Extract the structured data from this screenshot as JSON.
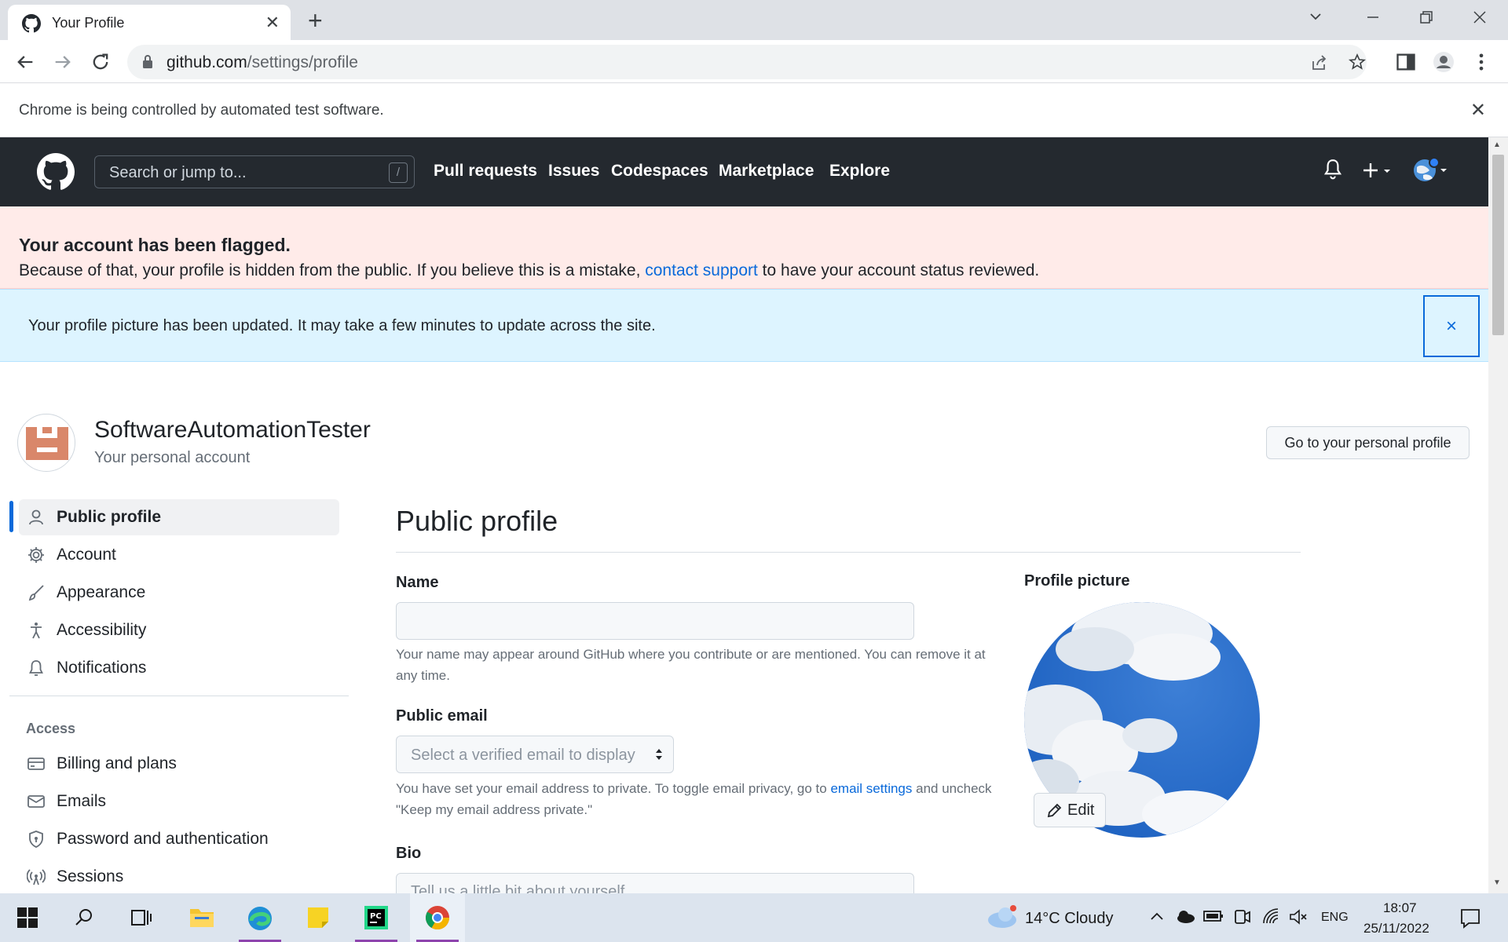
{
  "browser": {
    "tab_title": "Your Profile",
    "url_host": "github.com",
    "url_path": "/settings/profile",
    "infobar_text": "Chrome is being controlled by automated test software."
  },
  "gh_header": {
    "search_placeholder": "Search or jump to...",
    "search_shortcut": "/",
    "nav": [
      "Pull requests",
      "Issues",
      "Codespaces",
      "Marketplace",
      "Explore"
    ]
  },
  "flash_error": {
    "title": "Your account has been flagged.",
    "body_before": "Because of that, your profile is hidden from the public. If you believe this is a mistake, ",
    "link": "contact support",
    "body_after": " to have your account status reviewed."
  },
  "flash_info": {
    "text": "Your profile picture has been updated. It may take a few minutes to update across the site.",
    "close": "×"
  },
  "account": {
    "name": "SoftwareAutomationTester",
    "subtitle": "Your personal account",
    "profile_button": "Go to your personal profile"
  },
  "sidebar": {
    "items": [
      {
        "label": "Public profile",
        "icon": "person-icon"
      },
      {
        "label": "Account",
        "icon": "gear-icon"
      },
      {
        "label": "Appearance",
        "icon": "paintbrush-icon"
      },
      {
        "label": "Accessibility",
        "icon": "accessibility-icon"
      },
      {
        "label": "Notifications",
        "icon": "bell-icon"
      }
    ],
    "access_heading": "Access",
    "access_items": [
      {
        "label": "Billing and plans",
        "icon": "credit-card-icon"
      },
      {
        "label": "Emails",
        "icon": "mail-icon"
      },
      {
        "label": "Password and authentication",
        "icon": "shield-lock-icon"
      },
      {
        "label": "Sessions",
        "icon": "broadcast-icon"
      }
    ]
  },
  "main": {
    "title": "Public profile",
    "name_label": "Name",
    "name_value": "",
    "name_help": "Your name may appear around GitHub where you contribute or are mentioned. You can remove it at any time.",
    "email_label": "Public email",
    "email_select": "Select a verified email to display",
    "email_help_before": "You have set your email address to private. To toggle email privacy, go to ",
    "email_help_link": "email settings",
    "email_help_after": " and uncheck \"Keep my email address private.\"",
    "bio_label": "Bio",
    "bio_placeholder": "Tell us a little bit about yourself",
    "pp_label": "Profile picture",
    "pp_edit": "Edit"
  },
  "taskbar": {
    "weather": "14°C  Cloudy",
    "lang": "ENG",
    "time": "18:07",
    "date": "25/11/2022"
  },
  "colors": {
    "gh_header": "#24292f",
    "link": "#0969da",
    "flash_error_bg": "#ffebe9",
    "flash_info_bg": "#ddf4ff"
  }
}
